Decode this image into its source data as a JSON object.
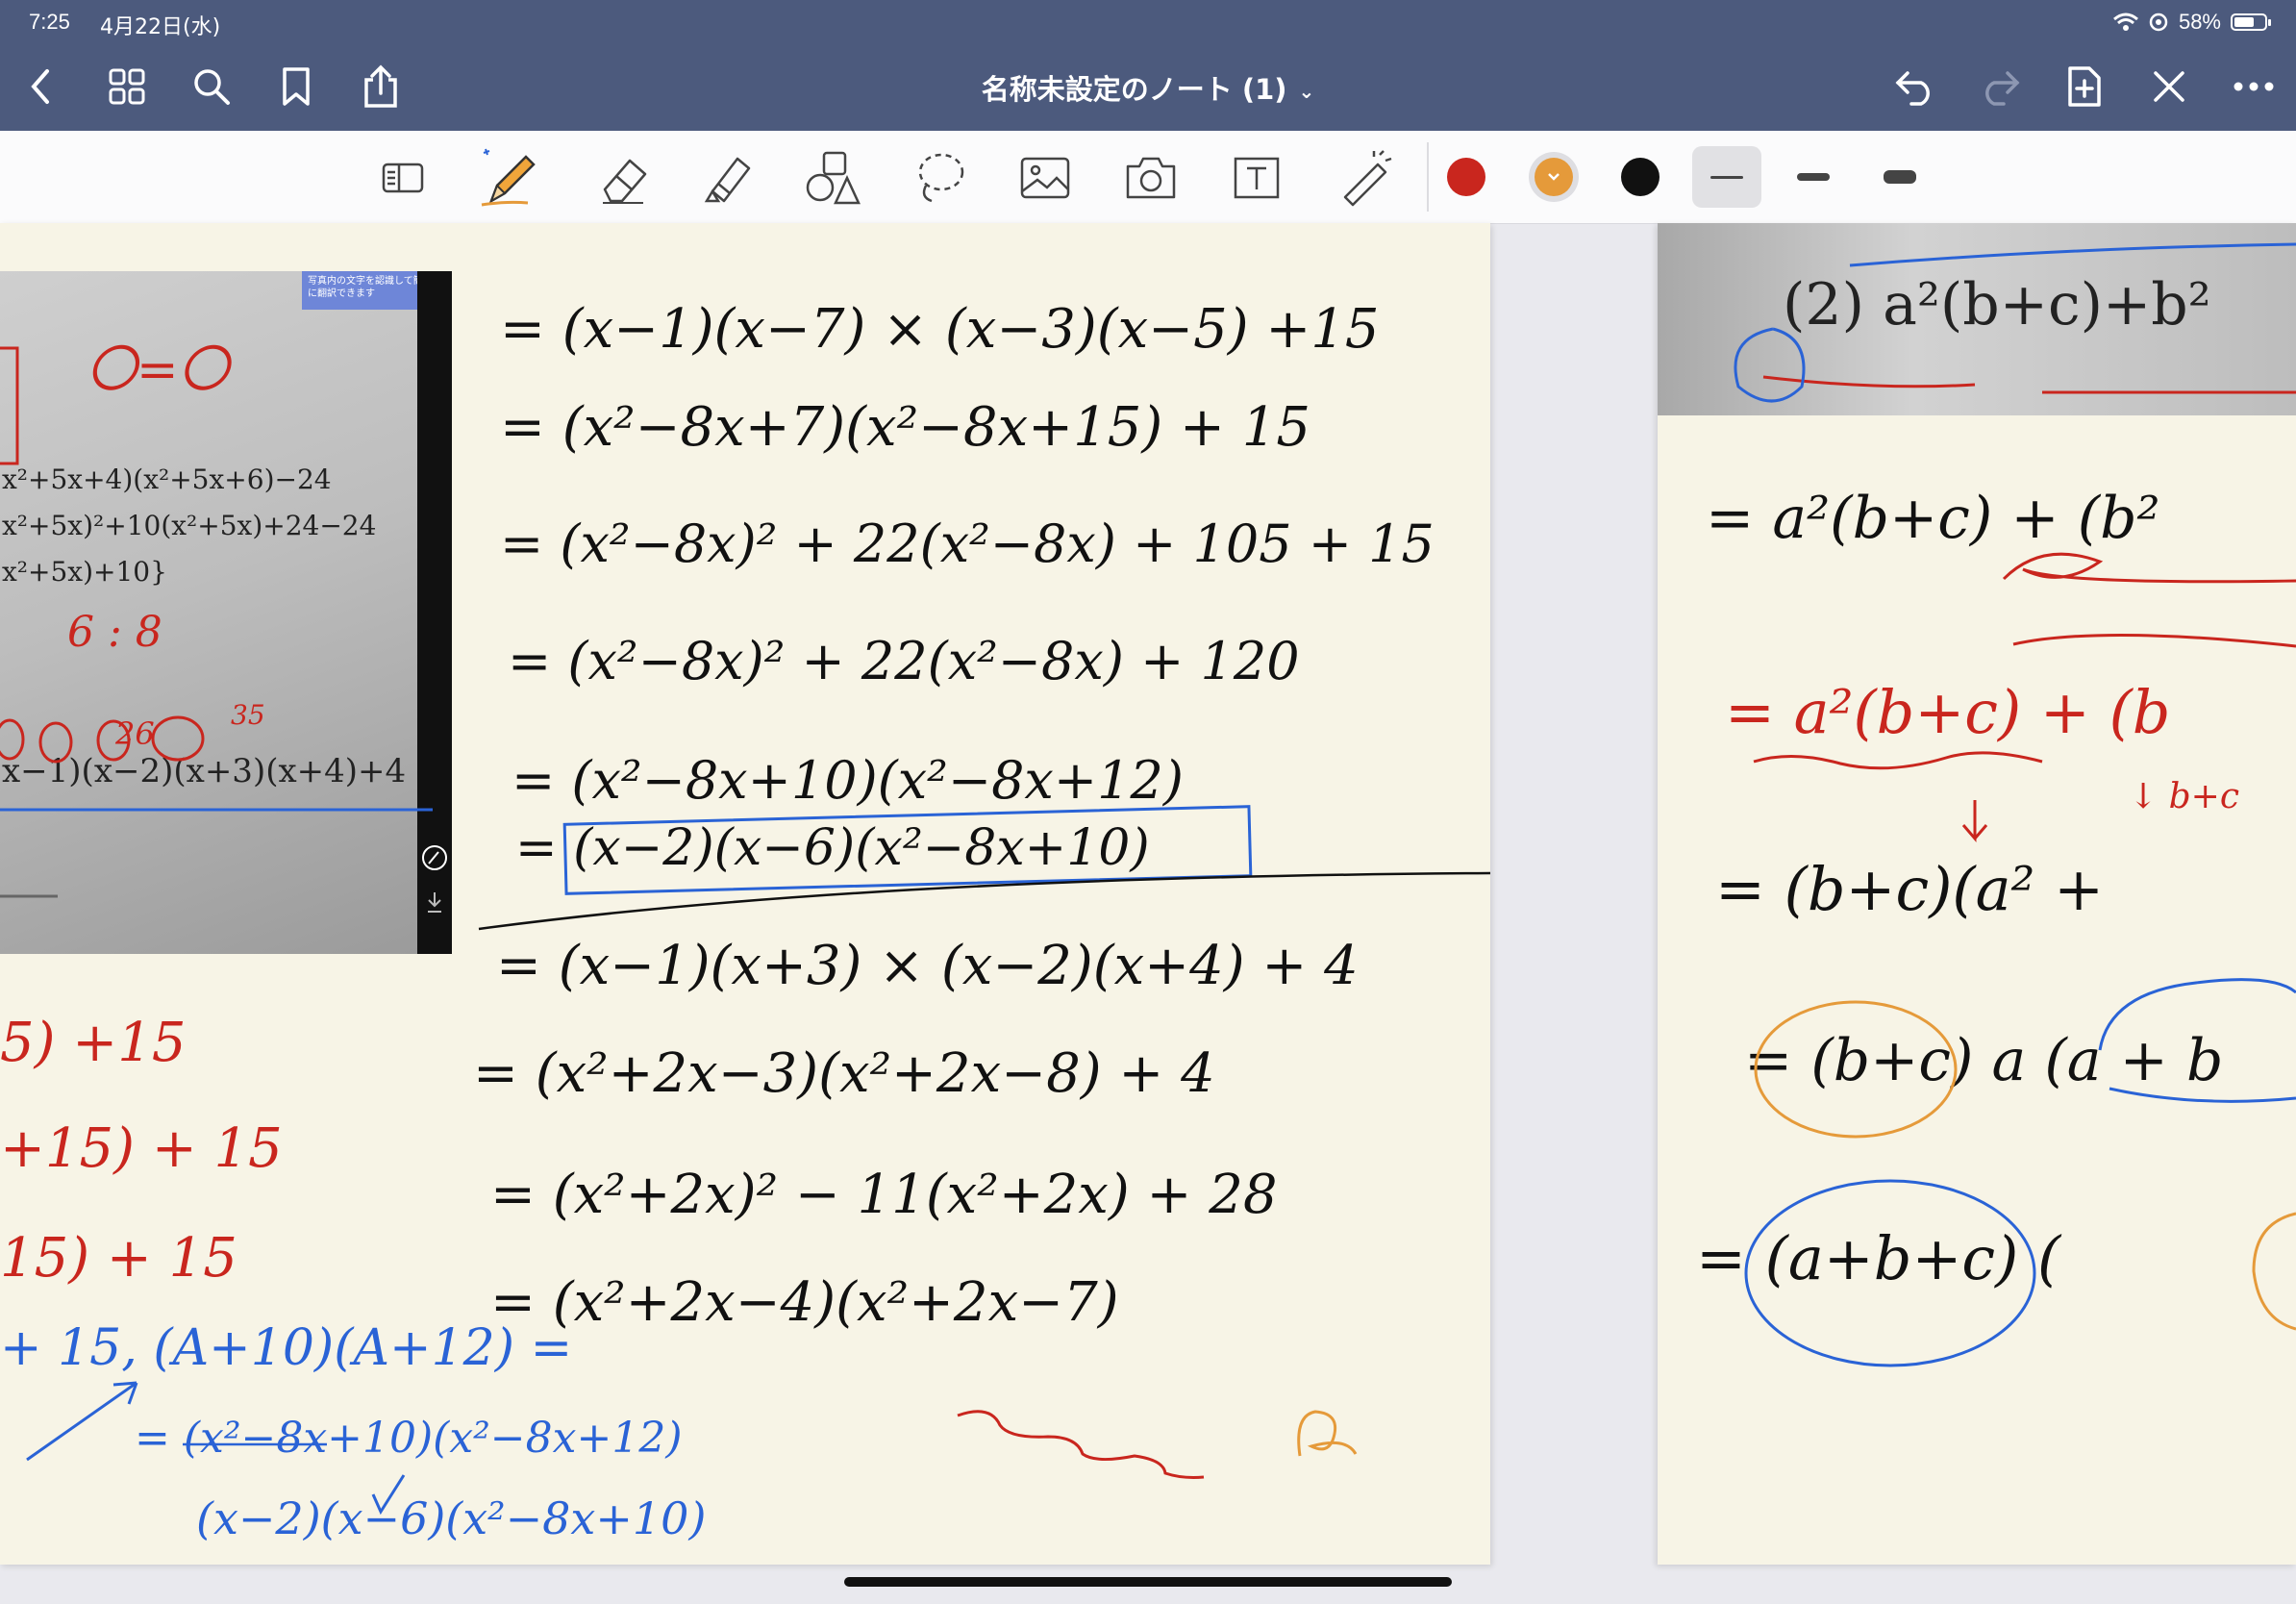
{
  "status_bar": {
    "time": "7:25",
    "date": "4月22日(水)",
    "battery": "58%"
  },
  "nav": {
    "title": "名称未設定のノート (1)",
    "title_chevron": "⌄",
    "left_icons": [
      "back-icon",
      "thumbnails-icon",
      "search-icon",
      "bookmark-icon",
      "share-icon"
    ],
    "right_icons": [
      "undo-icon",
      "redo-icon",
      "add-page-icon",
      "close-tools-icon",
      "more-icon"
    ]
  },
  "toolbar": {
    "tools": [
      "sidebar-icon",
      "pen-icon",
      "eraser-icon",
      "highlighter-icon",
      "shapes-icon",
      "lasso-icon",
      "image-icon",
      "camera-icon",
      "textbox-icon",
      "laser-icon"
    ],
    "colors": {
      "red": "#c9261e",
      "orange": "#e59a3a",
      "black": "#111111"
    },
    "selected_color": "orange",
    "stroke_widths": [
      "thin",
      "medium",
      "thick"
    ],
    "selected_stroke": "thin"
  },
  "photo": {
    "banner": "写真内の文字を認識して簡単に翻訳できます",
    "lines": [
      "x²+5x+4)(x²+5x+6)−24",
      "x²+5x)²+10(x²+5x)+24−24",
      "x²+5x)+10}",
      "x−1)(x−2)(x+3)(x+4)+4"
    ]
  },
  "photo_right": {
    "line": "(2)  a²(b+c)+b²"
  },
  "handwriting_main": [
    "= (x−1)(x−7) × (x−3)(x−5) +15",
    "= (x²−8x+7)(x²−8x+15) + 15",
    "= (x²−8x)² + 22(x²−8x) + 105 + 15",
    "= (x²−8x)² + 22(x²−8x) + 120",
    "= (x²−8x+10)(x²−8x+12)",
    "= (x−2)(x−6)(x²−8x+10)",
    "= (x−1)(x+3) × (x−2)(x+4) + 4",
    "= (x²+2x−3)(x²+2x−8) + 4",
    "= (x²+2x)² − 11(x²+2x) + 28",
    "= (x²+2x−4)(x²+2x−7)"
  ],
  "handwriting_left_red": [
    "5) +15",
    "+15) + 15",
    "15) + 15"
  ],
  "handwriting_left_blue": [
    "+ 15,  (A+10)(A+12) =",
    "= (x²−8x+10)(x²−8x+12)",
    "(x−2)(x−6)(x²−8x+10)"
  ],
  "handwriting_photo_red": [
    "〇=〇",
    "6 : 8",
    "26",
    "35"
  ],
  "handwriting_right": [
    "= a²(b+c) + (b²",
    "= a²(b+c) + (b",
    "↓ b+c",
    "= (b+c)(a² +",
    "= (b+c) a (a + b",
    "= (a+b+c) ("
  ]
}
